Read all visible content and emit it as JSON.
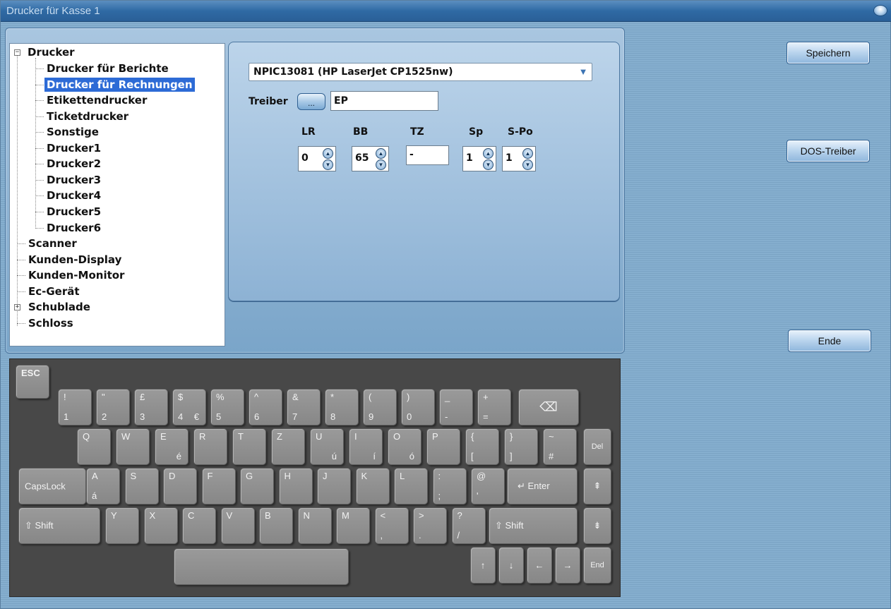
{
  "window": {
    "title": "Drucker für Kasse 1"
  },
  "tree": {
    "root": "Drucker",
    "children": [
      "Drucker für Berichte",
      "Drucker für Rechnungen",
      "Etikettendrucker",
      "Ticketdrucker",
      "Sonstige",
      "Drucker1",
      "Drucker2",
      "Drucker3",
      "Drucker4",
      "Drucker5",
      "Drucker6"
    ],
    "selected": "Drucker für Rechnungen",
    "top_level": [
      "Scanner",
      "Kunden-Display",
      "Kunden-Monitor",
      "Ec-Gerät",
      "Schublade",
      "Schloss"
    ],
    "expander_minus": "−",
    "expander_plus": "+"
  },
  "config": {
    "printer_select": "NPIC13081 (HP LaserJet CP1525nw)",
    "driver_label": "Treiber",
    "driver_button": "...",
    "driver_value": "EP",
    "fields": [
      {
        "label": "LR",
        "value": "0"
      },
      {
        "label": "BB",
        "value": "65"
      },
      {
        "label": "TZ",
        "value": "-"
      },
      {
        "label": "Sp",
        "value": "1"
      },
      {
        "label": "S-Po",
        "value": "1"
      }
    ]
  },
  "side_buttons": {
    "save": "Speichern",
    "dos": "DOS-Treiber",
    "end": "Ende"
  },
  "keyboard": {
    "esc": "ESC",
    "row1": [
      {
        "t": "!",
        "b": "1"
      },
      {
        "t": "\"",
        "b": "2"
      },
      {
        "t": "£",
        "b": "3"
      },
      {
        "t": "$",
        "b": "4",
        "r": "€"
      },
      {
        "t": "%",
        "b": "5"
      },
      {
        "t": "^",
        "b": "6"
      },
      {
        "t": "&",
        "b": "7"
      },
      {
        "t": "*",
        "b": "8"
      },
      {
        "t": "(",
        "b": "9"
      },
      {
        "t": ")",
        "b": "0"
      },
      {
        "t": "_",
        "b": "-"
      },
      {
        "t": "+",
        "b": "="
      }
    ],
    "backspace": "⌫",
    "row2": [
      {
        "t": "Q",
        "r": ""
      },
      {
        "t": "W",
        "r": ""
      },
      {
        "t": "E",
        "r": "é"
      },
      {
        "t": "R",
        "r": ""
      },
      {
        "t": "T",
        "r": ""
      },
      {
        "t": "Z",
        "r": ""
      },
      {
        "t": "U",
        "r": "ú"
      },
      {
        "t": "I",
        "r": "í"
      },
      {
        "t": "O",
        "r": "ó"
      },
      {
        "t": "P",
        "r": ""
      },
      {
        "t": "{",
        "b": "["
      },
      {
        "t": "}",
        "b": "]"
      },
      {
        "t": "~",
        "b": "#"
      }
    ],
    "del": "Del",
    "capslock": "CapsLock",
    "row3": [
      {
        "t": "A",
        "b": "á"
      },
      {
        "t": "S",
        "b": ""
      },
      {
        "t": "D",
        "b": ""
      },
      {
        "t": "F",
        "b": ""
      },
      {
        "t": "G",
        "b": ""
      },
      {
        "t": "H",
        "b": ""
      },
      {
        "t": "J",
        "b": ""
      },
      {
        "t": "K",
        "b": ""
      },
      {
        "t": "L",
        "b": ""
      },
      {
        "t": ":",
        "b": ";"
      },
      {
        "t": "@",
        "b": "'"
      }
    ],
    "enter": "↵ Enter",
    "pgup": "⇞",
    "shift_left": "⇧  Shift",
    "row4": [
      {
        "t": "Y",
        "b": ""
      },
      {
        "t": "X",
        "b": ""
      },
      {
        "t": "C",
        "b": ""
      },
      {
        "t": "V",
        "b": ""
      },
      {
        "t": "B",
        "b": ""
      },
      {
        "t": "N",
        "b": ""
      },
      {
        "t": "M",
        "b": ""
      },
      {
        "t": "<",
        "b": ","
      },
      {
        "t": ">",
        "b": "."
      },
      {
        "t": "?",
        "b": "/"
      }
    ],
    "shift_right": "⇧      Shift",
    "pgdn": "⇟",
    "arrows": [
      "↑",
      "↓",
      "←",
      "→"
    ],
    "end": "End"
  }
}
